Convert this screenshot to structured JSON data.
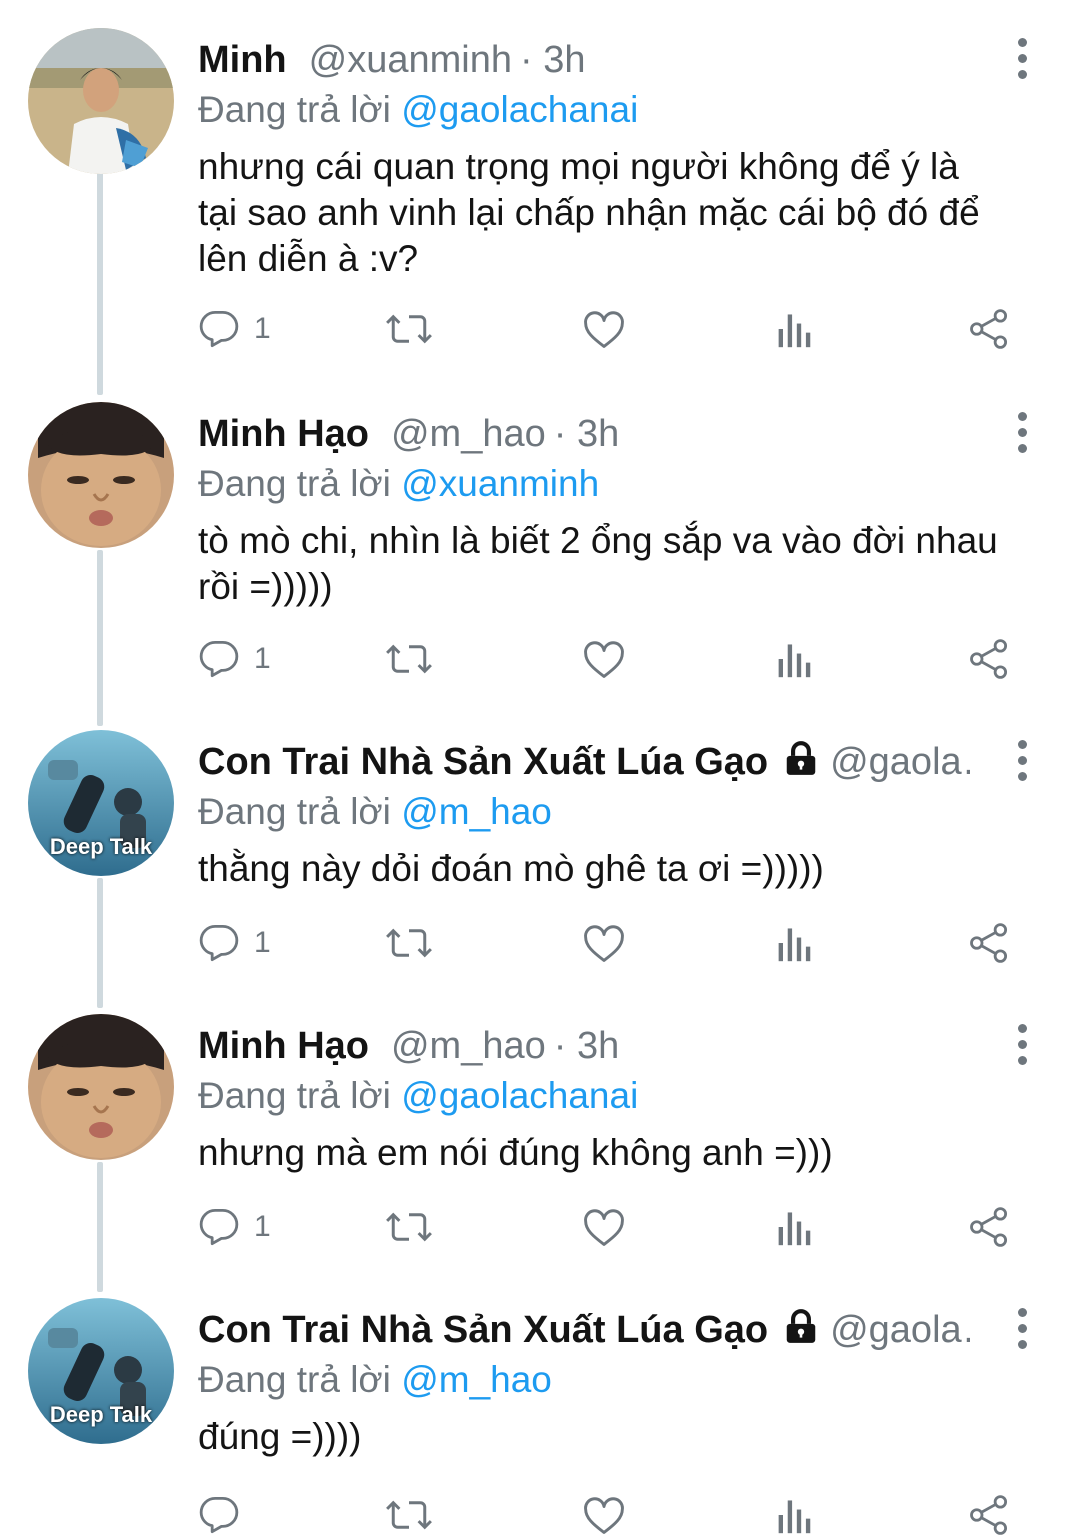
{
  "tweets": [
    {
      "name": "Minh",
      "handle": "@xuanminh",
      "time": "· 3h",
      "locked": false,
      "reply_prefix": "Đang trả lời",
      "reply_to": "@gaolachanai",
      "text": "nhưng cái quan trọng mọi người không để ý là\ntại sao anh vinh lại chấp nhận mặc cái bộ đó để\nlên diễn à :v?",
      "reply_count": "1",
      "avatar": "avatar-man-field"
    },
    {
      "name": "Minh Hạo",
      "handle": "@m_hao",
      "time": "· 3h",
      "locked": false,
      "reply_prefix": "Đang trả lời",
      "reply_to": "@xuanminh",
      "text": "tò mò chi, nhìn là biết 2 ổng sắp va vào đời nhau\nrồi =)))))",
      "reply_count": "1",
      "avatar": "avatar-boy-face"
    },
    {
      "name": "Con Trai Nhà Sản Xuất Lúa Gạo",
      "handle": "@gaola…",
      "time": "",
      "locked": true,
      "reply_prefix": "Đang trả lời",
      "reply_to": "@m_hao",
      "text": "thằng này dỏi đoán mò ghê ta ơi =)))))",
      "reply_count": "1",
      "avatar": "avatar-underwater",
      "avatar_caption": "Deep Talk"
    },
    {
      "name": "Minh Hạo",
      "handle": "@m_hao",
      "time": "· 3h",
      "locked": false,
      "reply_prefix": "Đang trả lời",
      "reply_to": "@gaolachanai",
      "text": "nhưng mà em nói đúng không anh =)))",
      "reply_count": "1",
      "avatar": "avatar-boy-face"
    },
    {
      "name": "Con Trai Nhà Sản Xuất Lúa Gạo",
      "handle": "@gaola…",
      "time": "",
      "locked": true,
      "reply_prefix": "Đang trả lời",
      "reply_to": "@m_hao",
      "text": "đúng =))))",
      "reply_count": "",
      "avatar": "avatar-underwater",
      "avatar_caption": "Deep Talk"
    }
  ],
  "colors": {
    "text": "#141414",
    "secondary": "#6e767d",
    "mention": "#1d9bf0",
    "thread_line": "#cfd9de"
  },
  "icons": [
    "reply-icon",
    "retweet-icon",
    "like-icon",
    "analytics-icon",
    "share-icon",
    "more-icon",
    "lock-icon"
  ]
}
